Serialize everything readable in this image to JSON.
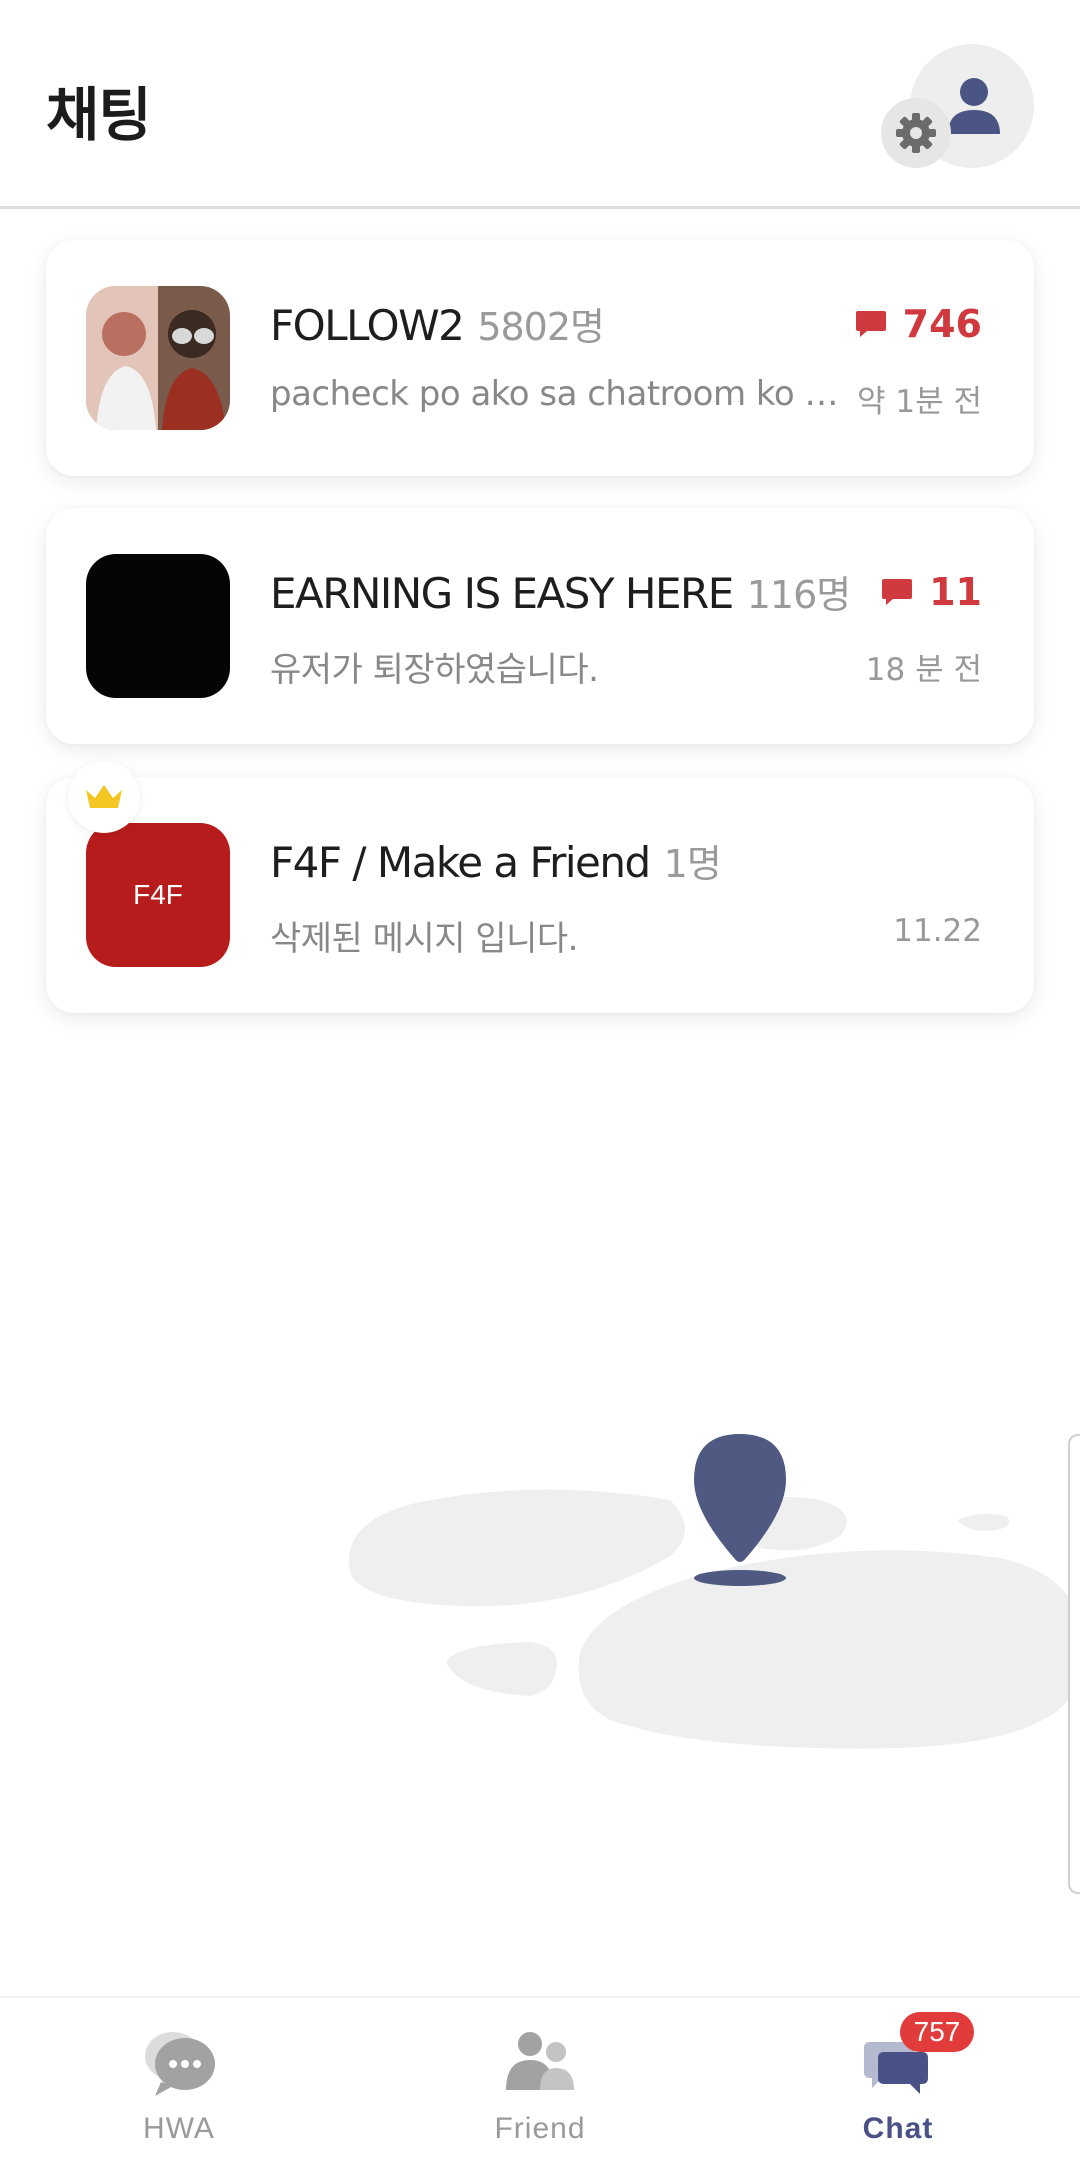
{
  "header": {
    "title": "채팅"
  },
  "rooms": [
    {
      "name": "FOLLOW2",
      "count": "5802명",
      "preview": "pacheck po ako sa chatroom ko po pls",
      "time": "약 1분 전",
      "unread": "746"
    },
    {
      "name": "EARNING IS EASY HERE",
      "count": "116명",
      "preview": "유저가 퇴장하였습니다.",
      "time": "18 분 전",
      "unread": "11"
    },
    {
      "name": "F4F / Make a Friend",
      "count": "1명",
      "preview": "삭제된 메시지 입니다.",
      "time": "11.22",
      "thumb_text": "F4F"
    }
  ],
  "nav": {
    "hwa": "HWA",
    "friend": "Friend",
    "chat": "Chat",
    "chat_badge": "757"
  },
  "colors": {
    "accent": "#4a5187",
    "unread_red": "#d03a3f",
    "f4f_thumb": "#b71c1c",
    "badge_red": "#e23b3b"
  },
  "icons": {
    "header": [
      "person-icon",
      "gear-icon"
    ],
    "room": [
      "chat-bubble-icon",
      "crown-icon"
    ],
    "nav": [
      "hwa-chat-icon",
      "friends-icon",
      "chat-icon"
    ],
    "illustration": "map-pin-icon"
  }
}
